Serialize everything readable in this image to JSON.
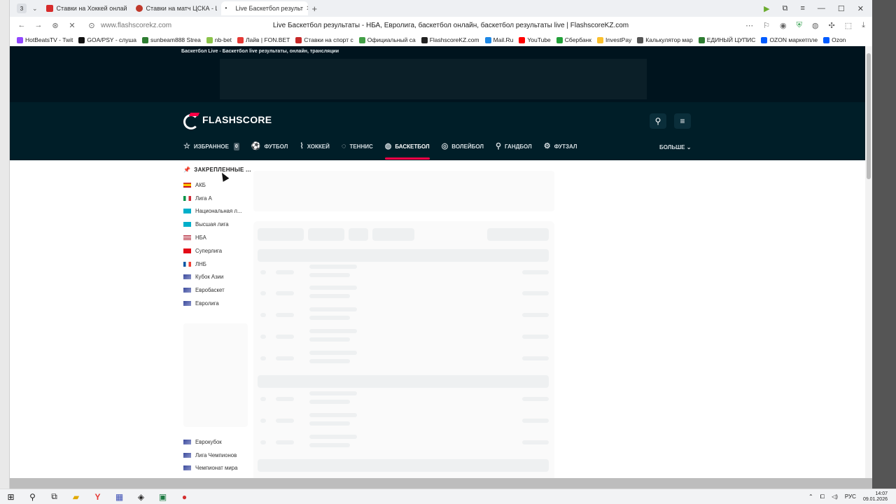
{
  "browser": {
    "tab_count": "3",
    "tabs": [
      {
        "label": "Ставки на Хоккей онлайн",
        "favicon_color": "#d72b2b"
      },
      {
        "label": "Ставки на матч ЦСКА - Ш",
        "favicon_color": "#c0392b"
      },
      {
        "label": "Live Баскетбол результ",
        "favicon_color": "#222222"
      }
    ],
    "url": "www.flashscorekz.com",
    "page_title": "Live Баскетбол результаты - НБА, Евролига, баскетбол онлайн, баскетбол результаты live | FlashscoreKZ.com",
    "bookmarks": [
      {
        "label": "HotBeatsTV - Twit",
        "color": "#9146ff"
      },
      {
        "label": "GOA/PSY - слуша",
        "color": "#111111"
      },
      {
        "label": "sunbeam888 Strea",
        "color": "#2e7d32"
      },
      {
        "label": "nb-bet",
        "color": "#8bc34a"
      },
      {
        "label": "Лайв | FON.BET",
        "color": "#e53935"
      },
      {
        "label": "Ставки на спорт с",
        "color": "#c62828"
      },
      {
        "label": "Официальный са",
        "color": "#43a047"
      },
      {
        "label": "FlashscoreKZ.com",
        "color": "#222222"
      },
      {
        "label": "Mail.Ru",
        "color": "#1e88e5"
      },
      {
        "label": "YouTube",
        "color": "#ff0000"
      },
      {
        "label": "Сбербанк",
        "color": "#21a038"
      },
      {
        "label": "InvestPay",
        "color": "#fbc02d"
      },
      {
        "label": "Калькулятор мар",
        "color": "#555555"
      },
      {
        "label": "ЕДИНЫЙ ЦУПИС",
        "color": "#2e7d32"
      },
      {
        "label": "OZON маркетпле",
        "color": "#005bff"
      },
      {
        "label": "Ozon",
        "color": "#005bff"
      }
    ]
  },
  "site": {
    "tagline": "Баскетбол Live - Баскетбол live результаты, онлайн, трансляции",
    "logo": "FLASHSCORE",
    "accent": "#ff0046",
    "nav": [
      {
        "label": "ИЗБРАННОЕ",
        "icon": "star-icon",
        "glyph": "☆",
        "badge": "0"
      },
      {
        "label": "ФУТБОЛ",
        "icon": "football-icon",
        "glyph": "⚽"
      },
      {
        "label": "ХОККЕЙ",
        "icon": "hockey-icon",
        "glyph": "⌇"
      },
      {
        "label": "ТЕННИС",
        "icon": "tennis-icon",
        "glyph": "◌"
      },
      {
        "label": "БАСКЕТБОЛ",
        "icon": "basketball-icon",
        "glyph": "◍",
        "active": true
      },
      {
        "label": "ВОЛЕЙБОЛ",
        "icon": "volleyball-icon",
        "glyph": "◎"
      },
      {
        "label": "ГАНДБОЛ",
        "icon": "handball-icon",
        "glyph": "⚲"
      },
      {
        "label": "ФУТЗАЛ",
        "icon": "futsal-icon",
        "glyph": "⚙"
      }
    ],
    "more": "БОЛЬШЕ"
  },
  "sidebar": {
    "pinned_title": "ЗАКРЕПЛЕННЫЕ ...",
    "leagues": [
      {
        "label": "АКБ",
        "flag": "spain"
      },
      {
        "label": "Лига А",
        "flag": "italy"
      },
      {
        "label": "Национальная л...",
        "flag": "kazakhstan"
      },
      {
        "label": "Высшая лига",
        "flag": "kazakhstan"
      },
      {
        "label": "НБА",
        "flag": "usa"
      },
      {
        "label": "Суперлига",
        "flag": "turkey"
      },
      {
        "label": "ЛНБ",
        "flag": "france"
      },
      {
        "label": "Кубок Азии",
        "flag": "world"
      },
      {
        "label": "Евробаскет",
        "flag": "world"
      },
      {
        "label": "Евролига",
        "flag": "world"
      }
    ],
    "bottom_leagues": [
      {
        "label": "Еврокубок",
        "flag": "world"
      },
      {
        "label": "Лига Чемпионов",
        "flag": "world"
      },
      {
        "label": "Чемпионат мира",
        "flag": "world"
      }
    ]
  },
  "taskbar": {
    "lang": "РУС",
    "time": "14:07",
    "date": "09.01.2026"
  }
}
